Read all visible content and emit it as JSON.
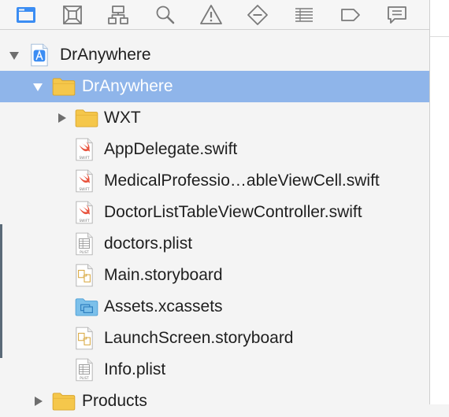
{
  "toolbar": {
    "buttons": [
      {
        "name": "project-navigator-icon",
        "active": true
      },
      {
        "name": "source-control-navigator-icon",
        "active": false
      },
      {
        "name": "symbol-navigator-icon",
        "active": false
      },
      {
        "name": "find-navigator-icon",
        "active": false
      },
      {
        "name": "issue-navigator-icon",
        "active": false
      },
      {
        "name": "test-navigator-icon",
        "active": false
      },
      {
        "name": "debug-navigator-icon",
        "active": false
      },
      {
        "name": "breakpoint-navigator-icon",
        "active": false
      },
      {
        "name": "report-navigator-icon",
        "active": false
      }
    ],
    "active_color": "#3b8df3",
    "inactive_color": "#7a7a7a"
  },
  "tree": [
    {
      "label": "DrAnywhere",
      "icon": "xcode-project-icon",
      "depth": 0,
      "disclosure": "expanded",
      "selected": false
    },
    {
      "label": "DrAnywhere",
      "icon": "folder-icon",
      "depth": 1,
      "disclosure": "expanded",
      "selected": true
    },
    {
      "label": "WXT",
      "icon": "folder-icon",
      "depth": 2,
      "disclosure": "collapsed",
      "selected": false
    },
    {
      "label": "AppDelegate.swift",
      "icon": "swift-file-icon",
      "depth": 2,
      "disclosure": "none",
      "selected": false
    },
    {
      "label": "MedicalProfessio…ableViewCell.swift",
      "icon": "swift-file-icon",
      "depth": 2,
      "disclosure": "none",
      "selected": false
    },
    {
      "label": "DoctorListTableViewController.swift",
      "icon": "swift-file-icon",
      "depth": 2,
      "disclosure": "none",
      "selected": false
    },
    {
      "label": "doctors.plist",
      "icon": "plist-file-icon",
      "depth": 2,
      "disclosure": "none",
      "selected": false
    },
    {
      "label": "Main.storyboard",
      "icon": "storyboard-file-icon",
      "depth": 2,
      "disclosure": "none",
      "selected": false
    },
    {
      "label": "Assets.xcassets",
      "icon": "asset-catalog-icon",
      "depth": 2,
      "disclosure": "none",
      "selected": false
    },
    {
      "label": "LaunchScreen.storyboard",
      "icon": "storyboard-file-icon",
      "depth": 2,
      "disclosure": "none",
      "selected": false
    },
    {
      "label": "Info.plist",
      "icon": "plist-file-icon",
      "depth": 2,
      "disclosure": "none",
      "selected": false
    },
    {
      "label": "Products",
      "icon": "folder-icon",
      "depth": 1,
      "disclosure": "collapsed",
      "selected": false
    }
  ],
  "colors": {
    "selection": "#8fb5ea",
    "folder": "#f5c74b",
    "swift": "#e8533d",
    "asset_folder": "#7cc0ea"
  }
}
